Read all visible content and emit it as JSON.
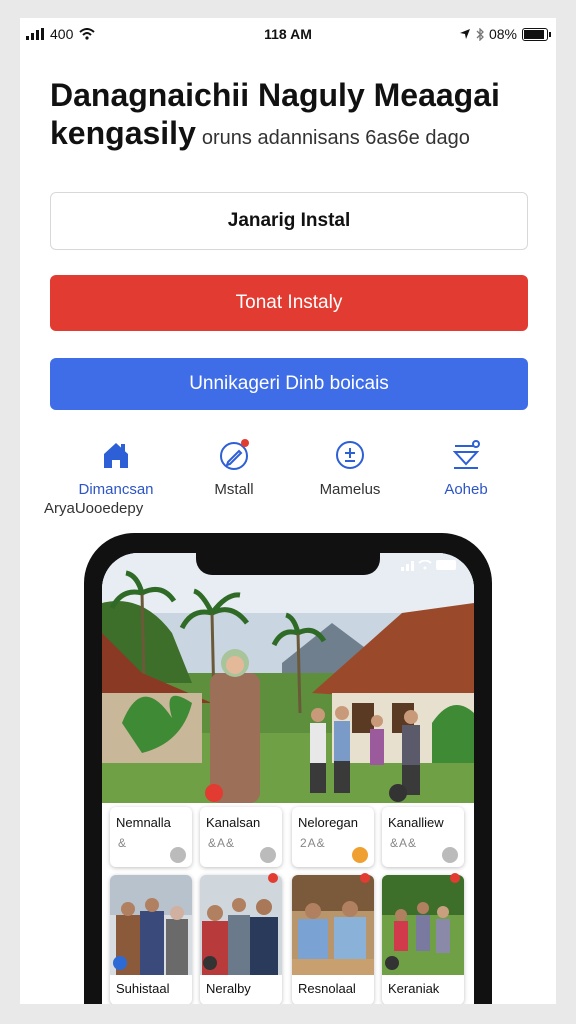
{
  "status_bar": {
    "signal": "400",
    "time": "118 AM",
    "battery": "08%"
  },
  "header": {
    "title": "Danagnaichii Naguly Meaagai kengasily",
    "title_line1": "Danagnaichii Naguly Meaagai",
    "title_line2": "kengasily",
    "subtitle": "oruns adannisans 6as6e dago"
  },
  "buttons": {
    "outline": "Janarig Instal",
    "red": "Tonat Instaly",
    "blue": "Unnikageri Dinb boicais"
  },
  "icon_row": [
    {
      "label": "Dimancsan",
      "icon": "home-icon"
    },
    {
      "label": "Mstall",
      "icon": "pen-icon"
    },
    {
      "label": "Mamelus",
      "icon": "plus-minus-icon"
    },
    {
      "label": "Aoheb",
      "icon": "funnel-icon"
    }
  ],
  "icon_row_sublabel": "AryaUooedepy",
  "phone": {
    "cards_top": [
      {
        "name": "Nemnalla",
        "meta": "& "
      },
      {
        "name": "Kanalsan",
        "meta": "&A&"
      },
      {
        "name": "Neloregan",
        "meta": "2A&"
      },
      {
        "name": "Kanalliew",
        "meta": "&A&"
      }
    ],
    "cards_bottom": [
      {
        "name": "Suhistaal"
      },
      {
        "name": "Neralby"
      },
      {
        "name": "Resnolaal"
      },
      {
        "name": "Keraniak"
      }
    ]
  },
  "colors": {
    "red": "#e23b31",
    "blue": "#3f6de8",
    "link_blue": "#2d55c7"
  }
}
